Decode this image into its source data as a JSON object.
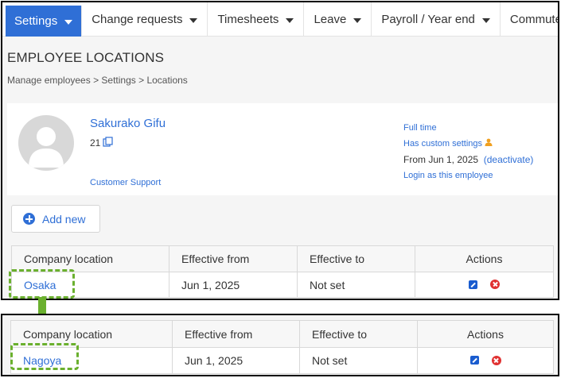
{
  "nav": {
    "items": [
      {
        "label": "Settings",
        "active": true
      },
      {
        "label": "Change requests"
      },
      {
        "label": "Timesheets"
      },
      {
        "label": "Leave"
      },
      {
        "label": "Payroll / Year end"
      },
      {
        "label": "Commute ex"
      }
    ]
  },
  "page": {
    "title": "EMPLOYEE LOCATIONS",
    "breadcrumb": "Manage employees > Settings > Locations"
  },
  "employee": {
    "name": "Sakurako Gifu",
    "id": "21",
    "support_link": "Customer Support",
    "employment_type": "Full time",
    "custom_settings": "Has custom settings",
    "from_text": "From Jun 1, 2025",
    "deactivate": "(deactivate)",
    "login_as": "Login as this employee"
  },
  "buttons": {
    "add_new": "Add new"
  },
  "table": {
    "headers": [
      "Company location",
      "Effective from",
      "Effective to",
      "Actions"
    ],
    "before_row": [
      "Osaka",
      "Jun 1, 2025",
      "Not set"
    ],
    "after_row": [
      "Nagoya",
      "Jun 1, 2025",
      "Not set"
    ]
  },
  "colors": {
    "accent": "#2f6fd6",
    "highlight": "#6ab02e",
    "delete": "#e03131"
  }
}
